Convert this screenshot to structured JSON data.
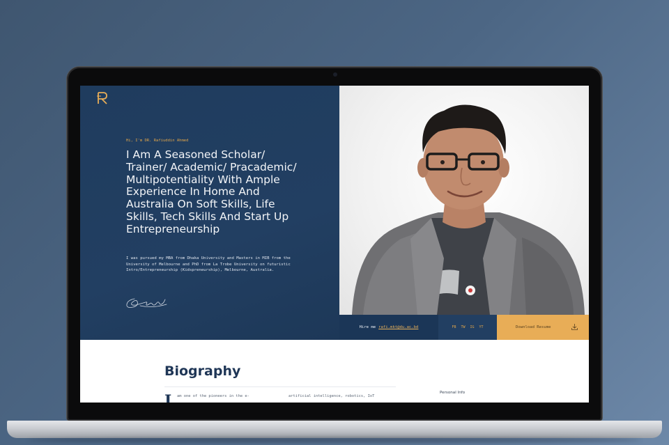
{
  "hero": {
    "greeting": "Hi, I'm DR. Rafiuddin Ahmed",
    "headline": "I Am A Seasoned Scholar/ Trainer/ Academic/ Pracademic/ Multipotentiality With Ample Experience In Home And Australia On Soft Skills, Life Skills, Tech Skills And Start Up Entrepreneurship",
    "intro": "I was pursued my MBA from Dhaka University and Masters in MIB from the University of Melbourne and PhD from La Trobe University on futuristic Intro/Entrepreneurship (Kidspreneurship), Melbourne, Australia."
  },
  "contact_bar": {
    "hire_label": "Hire me",
    "hire_email": "rafi.mkt@du.ac.bd",
    "social": [
      "FB",
      "TW",
      "IG",
      "YT"
    ],
    "download_label": "Download Resume"
  },
  "biography": {
    "title": "Biography",
    "dropcap": "I",
    "col1_start": "am one of the pioneers in the e-",
    "col2_start": "artificial intelligence, robotics, IoT",
    "sidebar_heading": "Personal Info"
  },
  "colors": {
    "navy": "#1f3c5e",
    "accent_gold": "#e8ad57",
    "background": "#4c6684"
  },
  "icons": [
    "logo-r-icon",
    "signature-image",
    "download-icon"
  ]
}
